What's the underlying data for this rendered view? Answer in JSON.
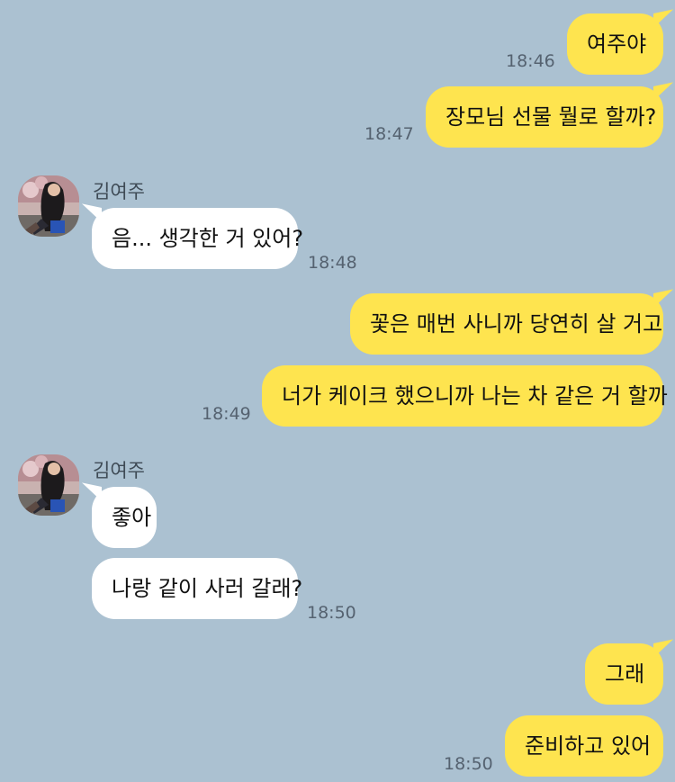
{
  "messages": [
    {
      "sender": "me",
      "text": "여주야",
      "time": "18:46"
    },
    {
      "sender": "me",
      "text": "장모님 선물 뭘로 할까?",
      "time": "18:47"
    },
    {
      "sender": "김여주",
      "text": "음... 생각한 거 있어?",
      "time": "18:48"
    },
    {
      "sender": "me",
      "text": "꽃은 매번 사니까 당연히 살 거고",
      "time": ""
    },
    {
      "sender": "me",
      "text": "너가 케이크 했으니까 나는 차 같은 거 할까",
      "time": "18:49"
    },
    {
      "sender": "김여주",
      "text": "좋아",
      "time": ""
    },
    {
      "sender": "김여주",
      "text": "나랑 같이 사러 갈래?",
      "time": "18:50"
    },
    {
      "sender": "me",
      "text": "그래",
      "time": ""
    },
    {
      "sender": "me",
      "text": "준비하고 있어",
      "time": "18:50"
    }
  ],
  "contact": {
    "name": "김여주",
    "avatar_icon": "profile-photo"
  },
  "colors": {
    "background": "#abc1d1",
    "my_bubble": "#fee44f",
    "their_bubble": "#ffffff"
  }
}
